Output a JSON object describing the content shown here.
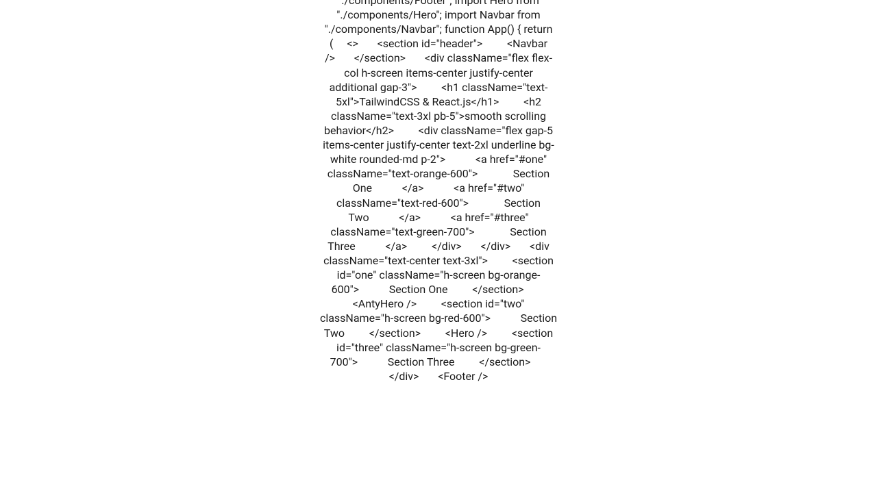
{
  "code_text": "\"./components/Footer\"; import Hero from \"./components/Hero\"; import Navbar from \"./components/Navbar\";  function App() {   return (     <>       <section id=\"header\">         <Navbar />       </section>       <div className=\"flex flex-col h-screen items-center justify-center additional gap-3\">         <h1 className=\"text-5xl\">TailwindCSS & React.js</h1>         <h2 className=\"text-3xl pb-5\">smooth scrolling behavior</h2>         <div className=\"flex gap-5 items-center justify-center text-2xl underline bg-white rounded-md p-2\">           <a href=\"#one\" className=\"text-orange-600\">             Section One           </a>           <a href=\"#two\" className=\"text-red-600\">             Section Two           </a>           <a href=\"#three\" className=\"text-green-700\">             Section Three           </a>         </div>       </div>       <div className=\"text-center text-3xl\">         <section id=\"one\" className=\"h-screen bg-orange-600\">           Section One         </section>         <AntyHero />         <section id=\"two\" className=\"h-screen bg-red-600\">           Section Two         </section>         <Hero />         <section id=\"three\" className=\"h-screen bg-green-700\">           Section Three         </section>       </div>       <Footer />"
}
